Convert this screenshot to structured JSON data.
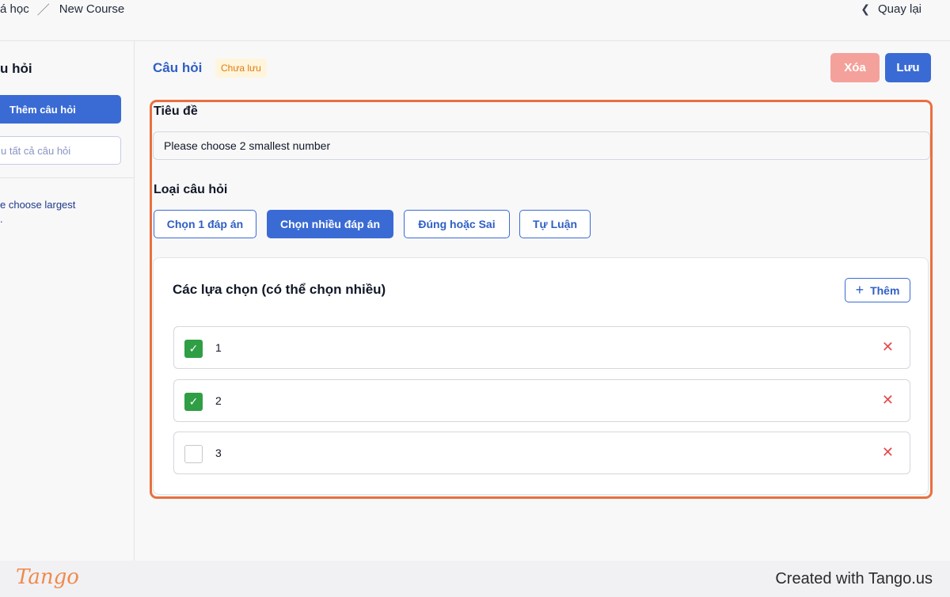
{
  "breadcrumb": {
    "parent": "á học",
    "current": "New Course"
  },
  "back_label": "Quay lại",
  "sidebar": {
    "title": "u hỏi",
    "add_button": "Thêm câu hỏi",
    "search_placeholder": "u tất cả câu hỏi",
    "items": [
      {
        "label": "e choose largest",
        "line2": "."
      }
    ]
  },
  "header": {
    "title": "Câu hỏi",
    "status_badge": "Chưa lưu",
    "delete_label": "Xóa",
    "save_label": "Lưu"
  },
  "form": {
    "title_label": "Tiêu đề",
    "title_value": "Please choose 2 smallest number",
    "type_label": "Loại câu hỏi",
    "types": [
      {
        "label": "Chọn 1 đáp án",
        "active": false
      },
      {
        "label": "Chọn nhiều đáp án",
        "active": true
      },
      {
        "label": "Đúng hoặc Sai",
        "active": false
      },
      {
        "label": "Tự Luận",
        "active": false
      }
    ],
    "options_title": "Các lựa chọn (có thể chọn nhiều)",
    "add_label": "Thêm",
    "options": [
      {
        "text": "1",
        "checked": true
      },
      {
        "text": "2",
        "checked": true
      },
      {
        "text": "3",
        "checked": false
      }
    ]
  },
  "footer": {
    "logo": "Tango",
    "credit": "Created with Tango.us"
  },
  "colors": {
    "primary": "#3a6bd4",
    "danger": "#f4a19b",
    "highlight": "#e9703f",
    "check": "#2f9e44",
    "badge_text": "#e07b12"
  }
}
